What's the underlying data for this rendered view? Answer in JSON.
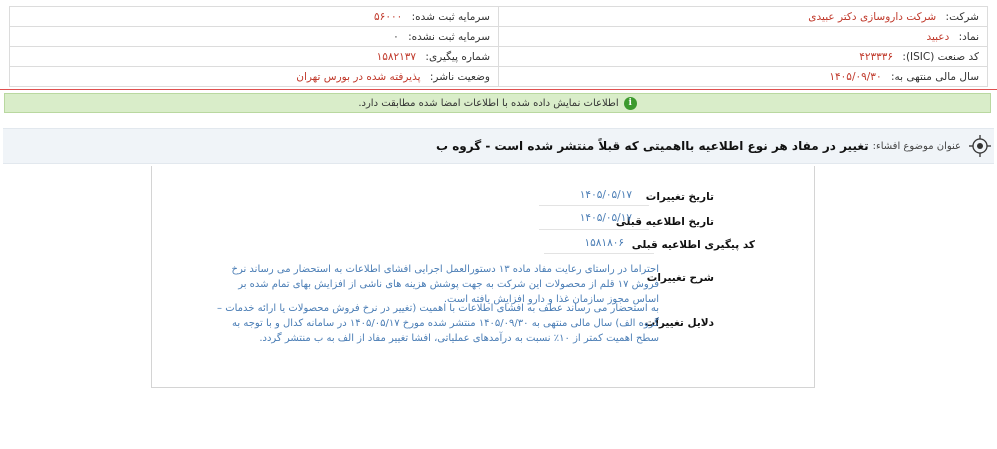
{
  "company": {
    "company_label": "شرکت:",
    "company_value": "شرکت داروسازی دکتر عبیدی",
    "symbol_label": "نماد:",
    "symbol_value": "دعبید",
    "isic_label": "کد صنعت (ISIC):",
    "isic_value": "۴۲۳۳۳۶",
    "fiscal_year_label": "سال مالی منتهی به:",
    "fiscal_year_value": "۱۴۰۵/۰۹/۳۰",
    "registered_capital_label": "سرمایه ثبت شده:",
    "registered_capital_value": "۵۶۰۰۰",
    "unregistered_capital_label": "سرمایه ثبت نشده:",
    "unregistered_capital_value": "۰",
    "tracking_label": "شماره پیگیری:",
    "tracking_value": "۱۵۸۲۱۳۷",
    "publisher_status_label": "وضعیت ناشر:",
    "publisher_status_value": "پذیرفته شده در بورس تهران"
  },
  "notice": {
    "text": "اطلاعات نمایش داده شده با اطلاعات امضا شده مطابقت دارد."
  },
  "disclosure": {
    "subject_label": "عنوان موضوع افشاء:",
    "subject_title": "تغییر در مفاد هر نوع اطلاعیه بااهمیتی که قبلاً منتشر شده است - گروه ب"
  },
  "details": {
    "change_date_label": "تاریخ تغییرات",
    "change_date_value": "۱۴۰۵/۰۵/۱۷",
    "prev_notice_date_label": "تاریخ اطلاعیه قبلی",
    "prev_notice_date_value": "۱۴۰۵/۰۵/۱۷",
    "prev_tracking_label": "کد پیگیری اطلاعیه قبلی",
    "prev_tracking_value": "۱۵۸۱۸۰۶",
    "change_desc_label": "شرح تغییرات",
    "change_desc_text": "احتراما در راستای رعایت مفاد ماده ۱۳ دستورالعمل اجرایی افشای اطلاعات به استحضار می رساند نرخ فروش ۱۷ قلم از محصولات این شرکت به جهت پوشش هزینه های ناشی از افزایش بهای تمام شده بر اساس مجوز سازمان غذا و دارو افزایش یافته است.",
    "change_reason_label": "دلایل تغییرات",
    "change_reason_text": "به استحضار می رساند عطف به افشای اطلاعات با اهمیت (تغییر در نرخ فروش محصولات یا ارائه خدمات – گروه الف) سال مالی منتهی به ۱۴۰۵/۰۹/۳۰ منتشر شده مورخ ۱۴۰۵/۰۵/۱۷ در سامانه کدال و با توجه به سطح اهمیت کمتر از ۱۰٪ نسبت به درآمدهای عملیاتی، افشا تغییر مفاد از الف به ب منتشر گردد."
  },
  "colors": {
    "accent_red": "#c0392b",
    "link_blue": "#4a7db5",
    "notice_green": "#d9edc9"
  }
}
